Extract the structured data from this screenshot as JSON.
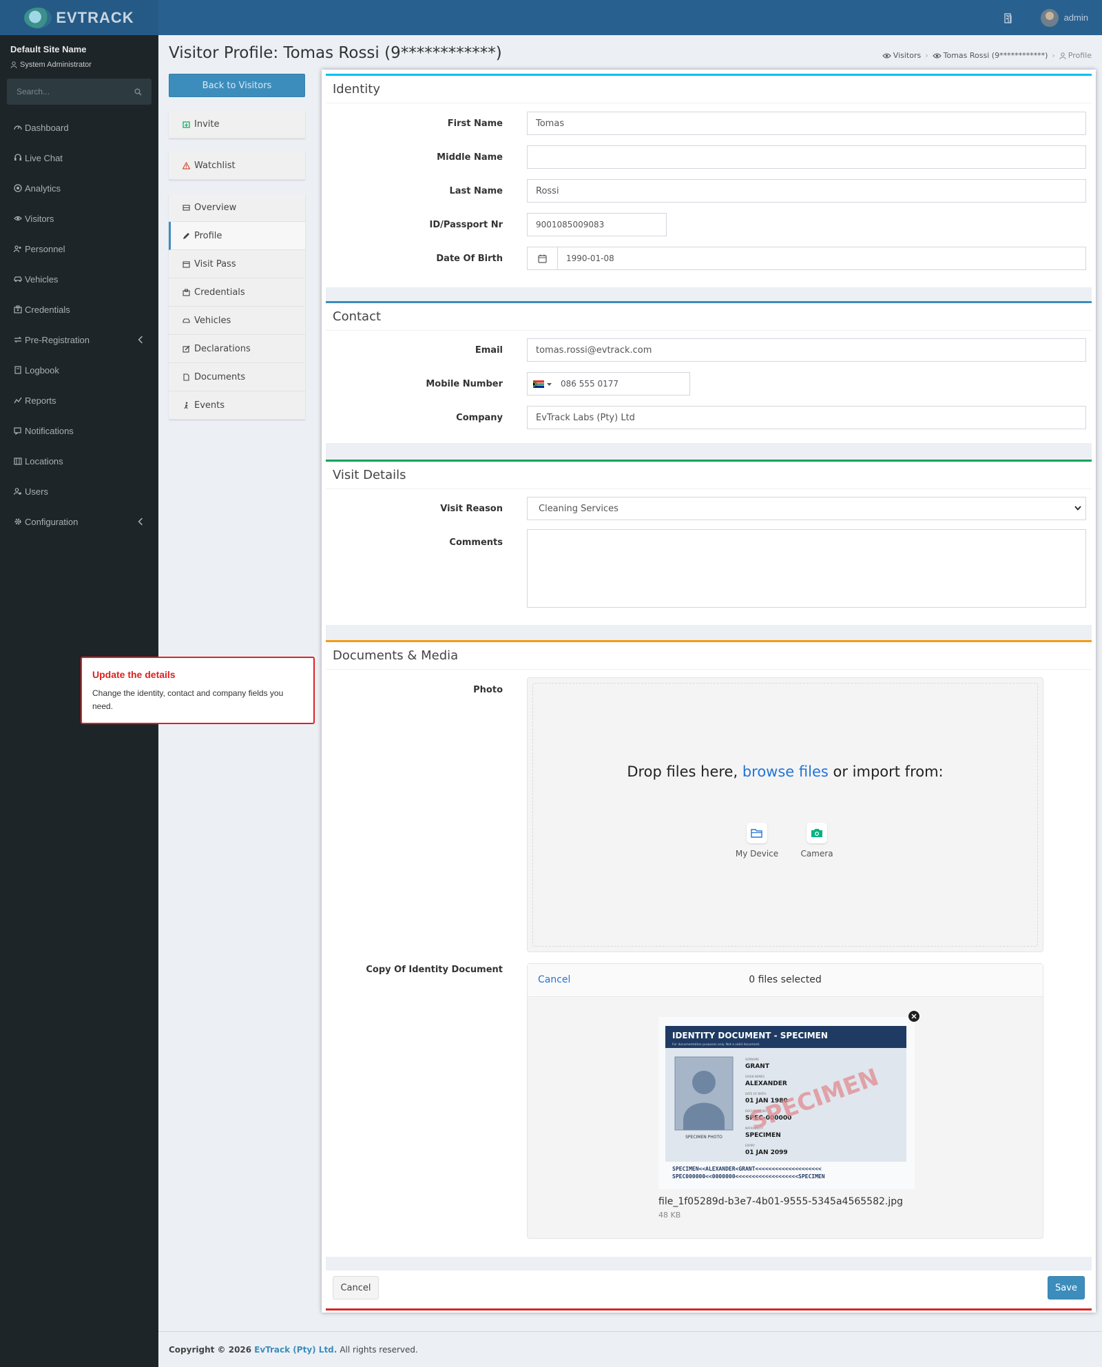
{
  "app": {
    "logo_text": "EVTRACK",
    "user": "admin"
  },
  "sidebar": {
    "site_name": "Default Site Name",
    "role": "System Administrator",
    "search_placeholder": "Search...",
    "items": [
      {
        "label": "Dashboard",
        "icon": "dashboard-icon"
      },
      {
        "label": "Live Chat",
        "icon": "headset-icon"
      },
      {
        "label": "Analytics",
        "icon": "target-icon"
      },
      {
        "label": "Visitors",
        "icon": "eye-icon"
      },
      {
        "label": "Personnel",
        "icon": "users-icon"
      },
      {
        "label": "Vehicles",
        "icon": "car-icon"
      },
      {
        "label": "Credentials",
        "icon": "id-card-icon"
      },
      {
        "label": "Pre-Registration",
        "icon": "exchange-icon"
      },
      {
        "label": "Logbook",
        "icon": "book-icon"
      },
      {
        "label": "Reports",
        "icon": "reports-icon"
      },
      {
        "label": "Notifications",
        "icon": "notifications-icon"
      },
      {
        "label": "Locations",
        "icon": "building-icon"
      },
      {
        "label": "Users",
        "icon": "users-cog-icon"
      },
      {
        "label": "Configuration",
        "icon": "gear-icon"
      }
    ]
  },
  "page": {
    "title": "Visitor Profile: Tomas Rossi (9************)",
    "breadcrumb": [
      "Visitors",
      "Tomas Rossi (9************)",
      "Profile"
    ]
  },
  "actions": {
    "back": "Back to Visitors",
    "invite": "Invite",
    "watchlist": "Watchlist",
    "menu": [
      "Overview",
      "Profile",
      "Visit Pass",
      "Credentials",
      "Vehicles",
      "Declarations",
      "Documents",
      "Events"
    ]
  },
  "identity": {
    "header": "Identity",
    "first_name_label": "First Name",
    "first_name": "Tomas",
    "middle_name_label": "Middle Name",
    "middle_name": "",
    "last_name_label": "Last Name",
    "last_name": "Rossi",
    "id_label": "ID/Passport Nr",
    "id": "9001085009083",
    "dob_label": "Date Of Birth",
    "dob": "1990-01-08"
  },
  "contact": {
    "header": "Contact",
    "email_label": "Email",
    "email": "tomas.rossi@evtrack.com",
    "mobile_label": "Mobile Number",
    "mobile": "086 555 0177",
    "company_label": "Company",
    "company": "EvTrack Labs (Pty) Ltd"
  },
  "visit": {
    "header": "Visit Details",
    "reason_label": "Visit Reason",
    "reason": "Cleaning Services",
    "comments_label": "Comments",
    "comments": ""
  },
  "documents": {
    "header": "Documents & Media",
    "photo_label": "Photo",
    "drop_prefix": "Drop files here,",
    "drop_link": "browse files",
    "drop_suffix": "or import from:",
    "my_device": "My Device",
    "camera": "Camera",
    "id_doc_label": "Copy Of Identity Document",
    "cancel": "Cancel",
    "files_selected": "0 files selected",
    "file_name": "file_1f05289d-b3e7-4b01-9555-5345a4565582.jpg",
    "file_size": "48 KB",
    "id_card": {
      "heading": "IDENTITY DOCUMENT - SPECIMEN",
      "subheading": "For documentation purposes only. Not a valid document.",
      "photo_caption": "SPECIMEN PHOTO",
      "fields": [
        {
          "label": "SURNAME",
          "value": "GRANT"
        },
        {
          "label": "GIVEN NAMES",
          "value": "ALEXANDER"
        },
        {
          "label": "DATE OF BIRTH",
          "value": "01 JAN 1980"
        },
        {
          "label": "DOCUMENT NO",
          "value": "SPEC-000000"
        },
        {
          "label": "NATIONALITY",
          "value": "SPECIMEN"
        },
        {
          "label": "EXPIRY",
          "value": "01 JAN 2099"
        }
      ],
      "watermark": "SPECIMEN",
      "mrz_1": "SPECIMEN<<ALEXANDER<GRANT<<<<<<<<<<<<<<<<<<<<",
      "mrz_2": "SPEC000000<<0000000<<<<<<<<<<<<<<<<<<<SPECIMEN"
    }
  },
  "form_buttons": {
    "cancel": "Cancel",
    "save": "Save"
  },
  "tooltip": {
    "title": "Update the details",
    "body": "Change the identity, contact and company fields you need."
  },
  "footer": {
    "copyright": "Copyright © 2026",
    "company": "EvTrack (Pty) Ltd.",
    "rights": "All rights reserved."
  },
  "colors": {
    "primary": "#3c8dbc",
    "identity_accent": "#00c0ef",
    "contact_accent": "#3c8dbc",
    "visit_accent": "#00a65a",
    "documents_accent": "#f39c12",
    "danger": "#dd4b39"
  }
}
